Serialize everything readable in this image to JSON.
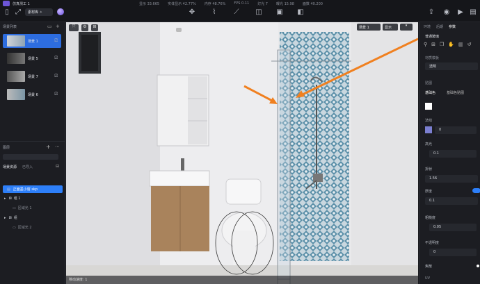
{
  "app": {
    "title": "仿真测工 1",
    "badge_label": "素材库"
  },
  "topbar": {
    "stats": [
      "显示 33.665",
      "实体显示 42.77%",
      "内存 48.76%",
      "FPS 0.11",
      "灯光 7",
      "曝光 15.98",
      "面数 40.200"
    ]
  },
  "left": {
    "scene_list_title": "场景列表",
    "scenes": [
      {
        "label": "场景 1",
        "selected": true
      },
      {
        "label": "场景 5",
        "selected": false
      },
      {
        "label": "场景 7",
        "selected": false
      },
      {
        "label": "场景 6",
        "selected": false
      }
    ],
    "layers_title": "图层",
    "tabs": [
      "场景资源",
      "已导入"
    ],
    "tree": [
      {
        "label": "正面墨小窗.skp",
        "selected": true,
        "indent": 0
      },
      {
        "label": "组 1",
        "selected": false,
        "indent": 0
      },
      {
        "label": "区域光 1",
        "selected": false,
        "indent": 1
      },
      {
        "label": "组",
        "selected": false,
        "indent": 0
      },
      {
        "label": "区域光 2",
        "selected": false,
        "indent": 1
      }
    ]
  },
  "viewport": {
    "scene_chip": "场景 1",
    "display_chip": "显示",
    "status_text": "移动速度: 1"
  },
  "right": {
    "tabs": [
      "环境",
      "后期",
      "参数"
    ],
    "material_name": "普通玻璃",
    "material_section": "材质模板",
    "material_value": "透明",
    "section_texture": "贴图",
    "sub_tabs": [
      "基础色",
      "基础色贴图"
    ],
    "normal_label": "法线",
    "normal_value": "0",
    "gloss_label": "高光",
    "gloss_value": "0.1",
    "refract_label": "折射",
    "refract_value": "1.56",
    "thickness_label": "厚度",
    "thickness_value": "0.1",
    "roughness_label": "粗糙度",
    "roughness_value": "0.05",
    "opacity_label": "不透明度",
    "opacity_value": "0",
    "vein_label": "焦散",
    "uv_label": "UV"
  },
  "colors": {
    "accent": "#2d7ff9",
    "arrow": "#f08020",
    "tile": "#5b8fa8"
  }
}
